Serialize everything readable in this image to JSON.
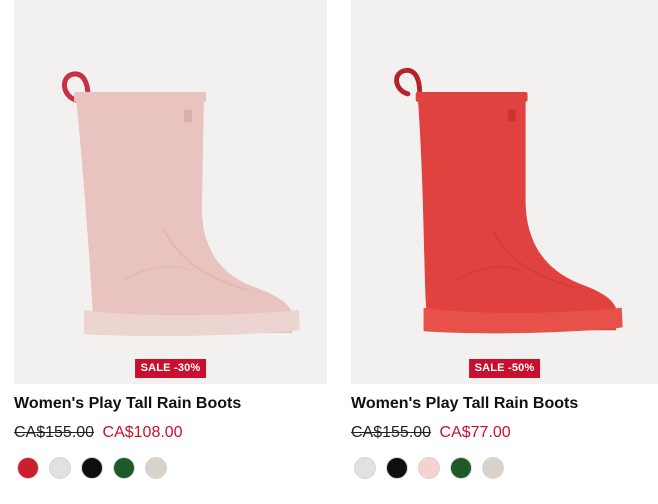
{
  "theme": {
    "sale_color": "#c8102e",
    "media_bg": "#f2f1f0"
  },
  "products": [
    {
      "badge": "SALE -30%",
      "title": "Women's Play Tall Rain Boots",
      "old_price": "CA$155.00",
      "new_price": "CA$108.00",
      "boot_color": "#e8c3c0",
      "boot_shade": "#d9aeab",
      "sole_color": "#ecd4d1",
      "handle_color": "#c63245",
      "swatches": [
        "#cc1f2d",
        "#e1e1e1",
        "#0f0f0f",
        "#1d5a2a",
        "#d8d2cb"
      ]
    },
    {
      "badge": "SALE -50%",
      "title": "Women's Play Tall Rain Boots",
      "old_price": "CA$155.00",
      "new_price": "CA$77.00",
      "boot_color": "#e0433f",
      "boot_shade": "#c9342f",
      "sole_color": "#e8504a",
      "handle_color": "#b4232b",
      "swatches": [
        "#e1e1e1",
        "#0f0f0f",
        "#f5d2cf",
        "#1d5a2a",
        "#d8d2cb"
      ]
    }
  ]
}
